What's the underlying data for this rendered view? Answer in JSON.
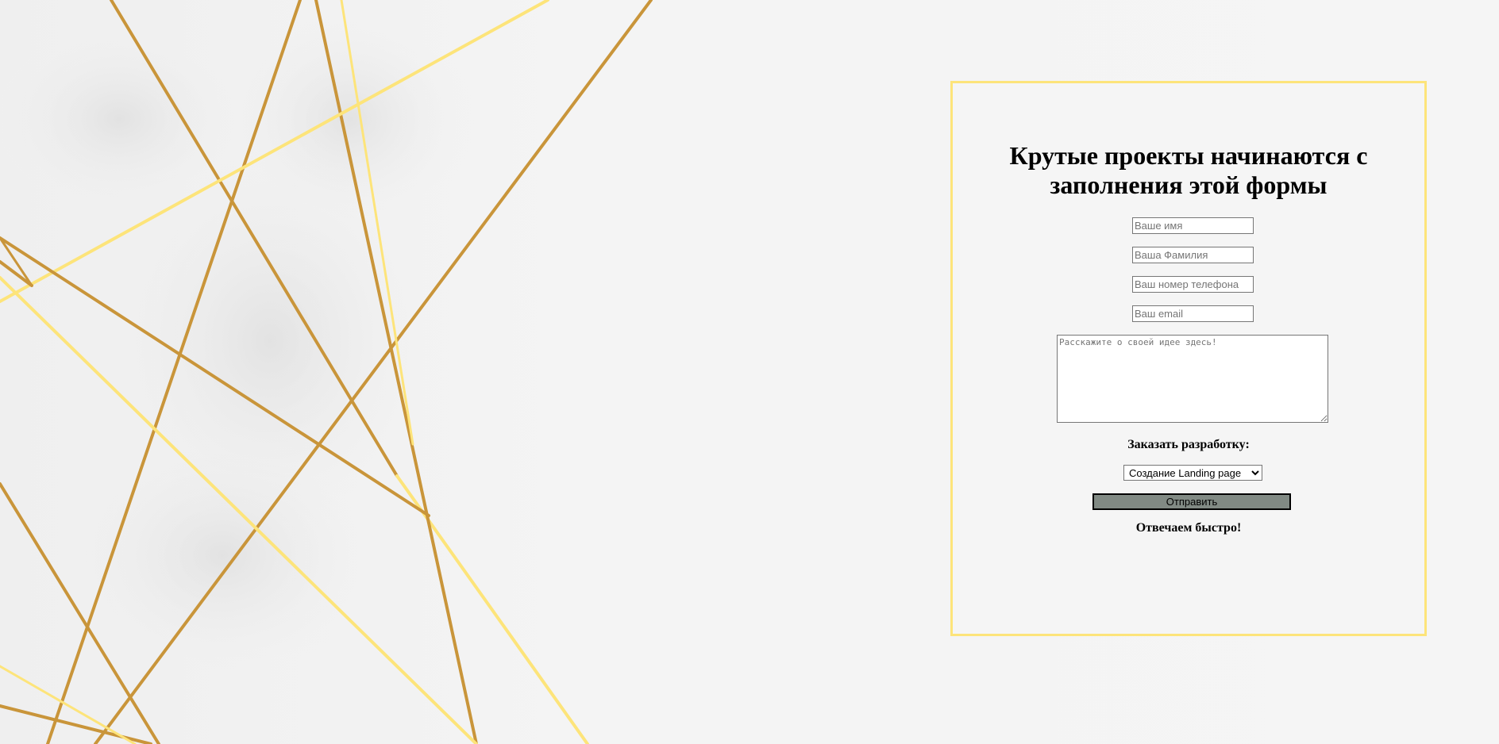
{
  "form": {
    "title": "Крутые проекты начинаются с заполнения этой формы",
    "name_placeholder": "Ваше имя",
    "surname_placeholder": "Ваша Фамилия",
    "phone_placeholder": "Ваш номер телефона",
    "email_placeholder": "Ваш email",
    "idea_placeholder": "Расскажите о своей идее здесь!",
    "order_label": "Заказать разработку:",
    "service_selected": "Создание Landing page",
    "submit_label": "Отправить",
    "note": "Отвечаем быстро!"
  },
  "colors": {
    "card_border": "#fde47a",
    "gold_dark": "#c9953a",
    "gold_light": "#fde47a",
    "button_bg": "#818a84"
  }
}
